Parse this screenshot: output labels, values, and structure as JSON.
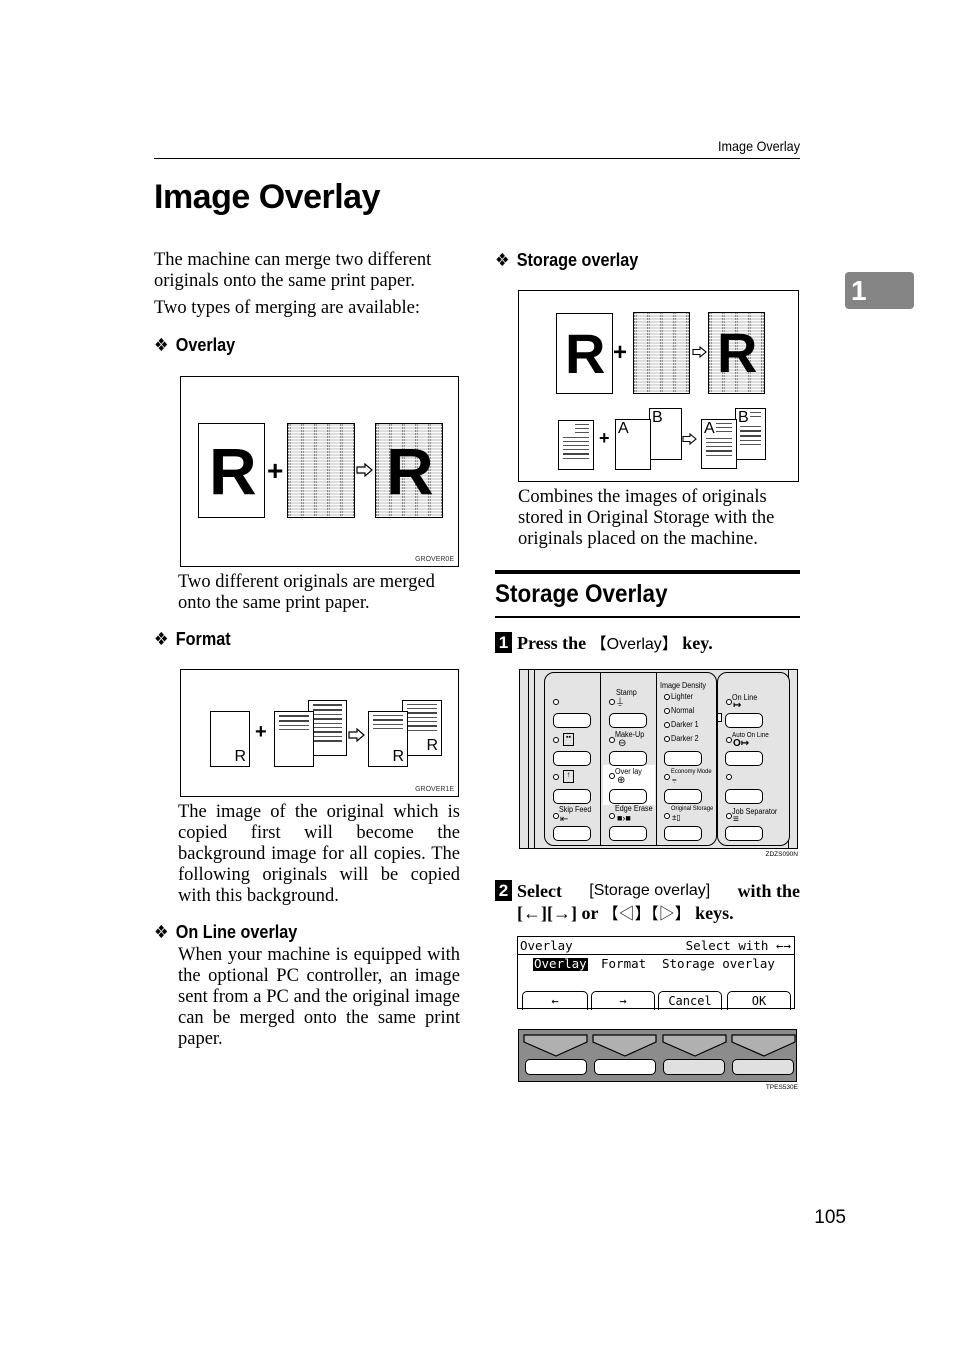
{
  "header": {
    "running_head": "Image Overlay",
    "page_title": "Image Overlay",
    "chapter_tab": "1",
    "page_number": "105"
  },
  "left_column": {
    "intro_p1": "The machine can merge two different originals onto the same print paper.",
    "intro_p2": "Two types of merging are available:",
    "sections": [
      {
        "heading": "Overlay",
        "figure_code": "GROVER0E",
        "description": "Two different originals are merged onto the same print paper."
      },
      {
        "heading": "Format",
        "figure_code": "GROVER1E",
        "description": "The image of the original which is copied first will become the background image for all copies. The following originals will be copied with this background."
      },
      {
        "heading": "On Line overlay",
        "description": "When your machine is equipped with the optional PC controller, an image sent from a PC and the original image can be merged onto the same print paper."
      }
    ]
  },
  "right_column": {
    "storage_subsection": {
      "heading": "Storage overlay",
      "description": "Combines the images of originals stored in Original Storage with the originals placed on the machine."
    },
    "section_title": "Storage Overlay",
    "steps": [
      {
        "number": "1",
        "pre": "Press the ",
        "key": "【Overlay】",
        "post": " key."
      },
      {
        "number": "2",
        "pre": "Select ",
        "key": "[Storage overlay]",
        "mid": " with the",
        "line2_keys": "[←][→]",
        "line2_or": " or ",
        "line2_tri": "【◁】【▷】",
        "post": " keys."
      }
    ],
    "control_panel": {
      "figure_code": "ZDZS090N",
      "column1": {
        "skip_feed": "Skip Feed"
      },
      "column2": {
        "stamp": "Stamp",
        "make_up": "Make-Up",
        "overlay": "Over lay",
        "edge_erase": "Edge Erase"
      },
      "column3": {
        "density_title": "Image Density",
        "density_options": [
          "Lighter",
          "Normal",
          "Darker 1",
          "Darker 2"
        ],
        "economy_mode": "Economy Mode",
        "original_storage": "Original Storage"
      },
      "column4": {
        "on_line": "On Line",
        "auto_on_line": "Auto On Line",
        "job_separator": "Job Separator"
      }
    },
    "lcd": {
      "title": "Overlay",
      "hint": "Select with ←→",
      "options": [
        "Overlay",
        "Format",
        "Storage overlay"
      ],
      "selected_option": "Overlay",
      "softkeys": [
        "←",
        "→",
        "Cancel",
        "OK"
      ],
      "figure_code": "TPES530E"
    },
    "figure_labels": {
      "sheet_a": "A",
      "sheet_b": "B",
      "letter_r": "R"
    }
  }
}
